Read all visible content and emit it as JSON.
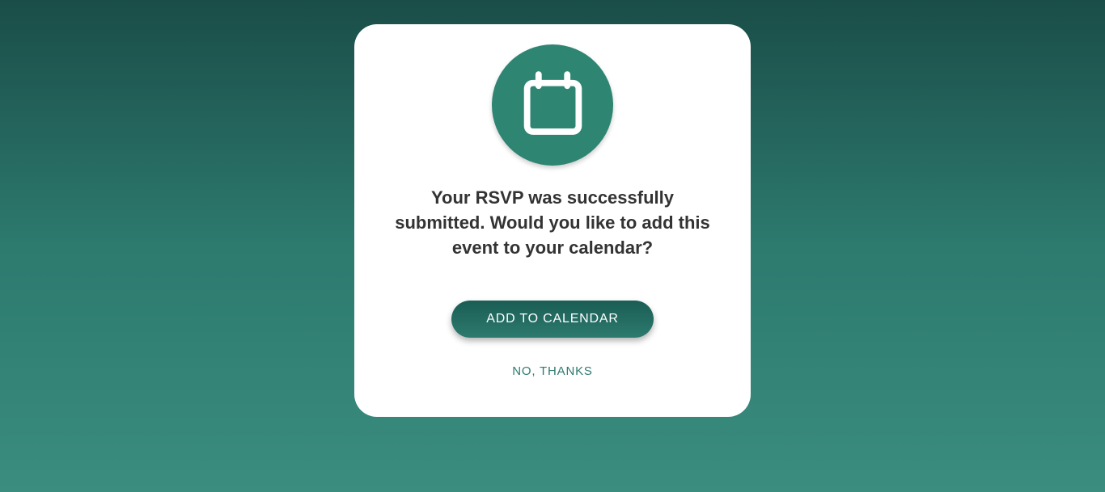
{
  "modal": {
    "message": "Your RSVP was successfully submitted. Would you like to add this event to your calendar?",
    "primary_button_label": "ADD TO CALENDAR",
    "secondary_button_label": "NO, THANKS"
  }
}
